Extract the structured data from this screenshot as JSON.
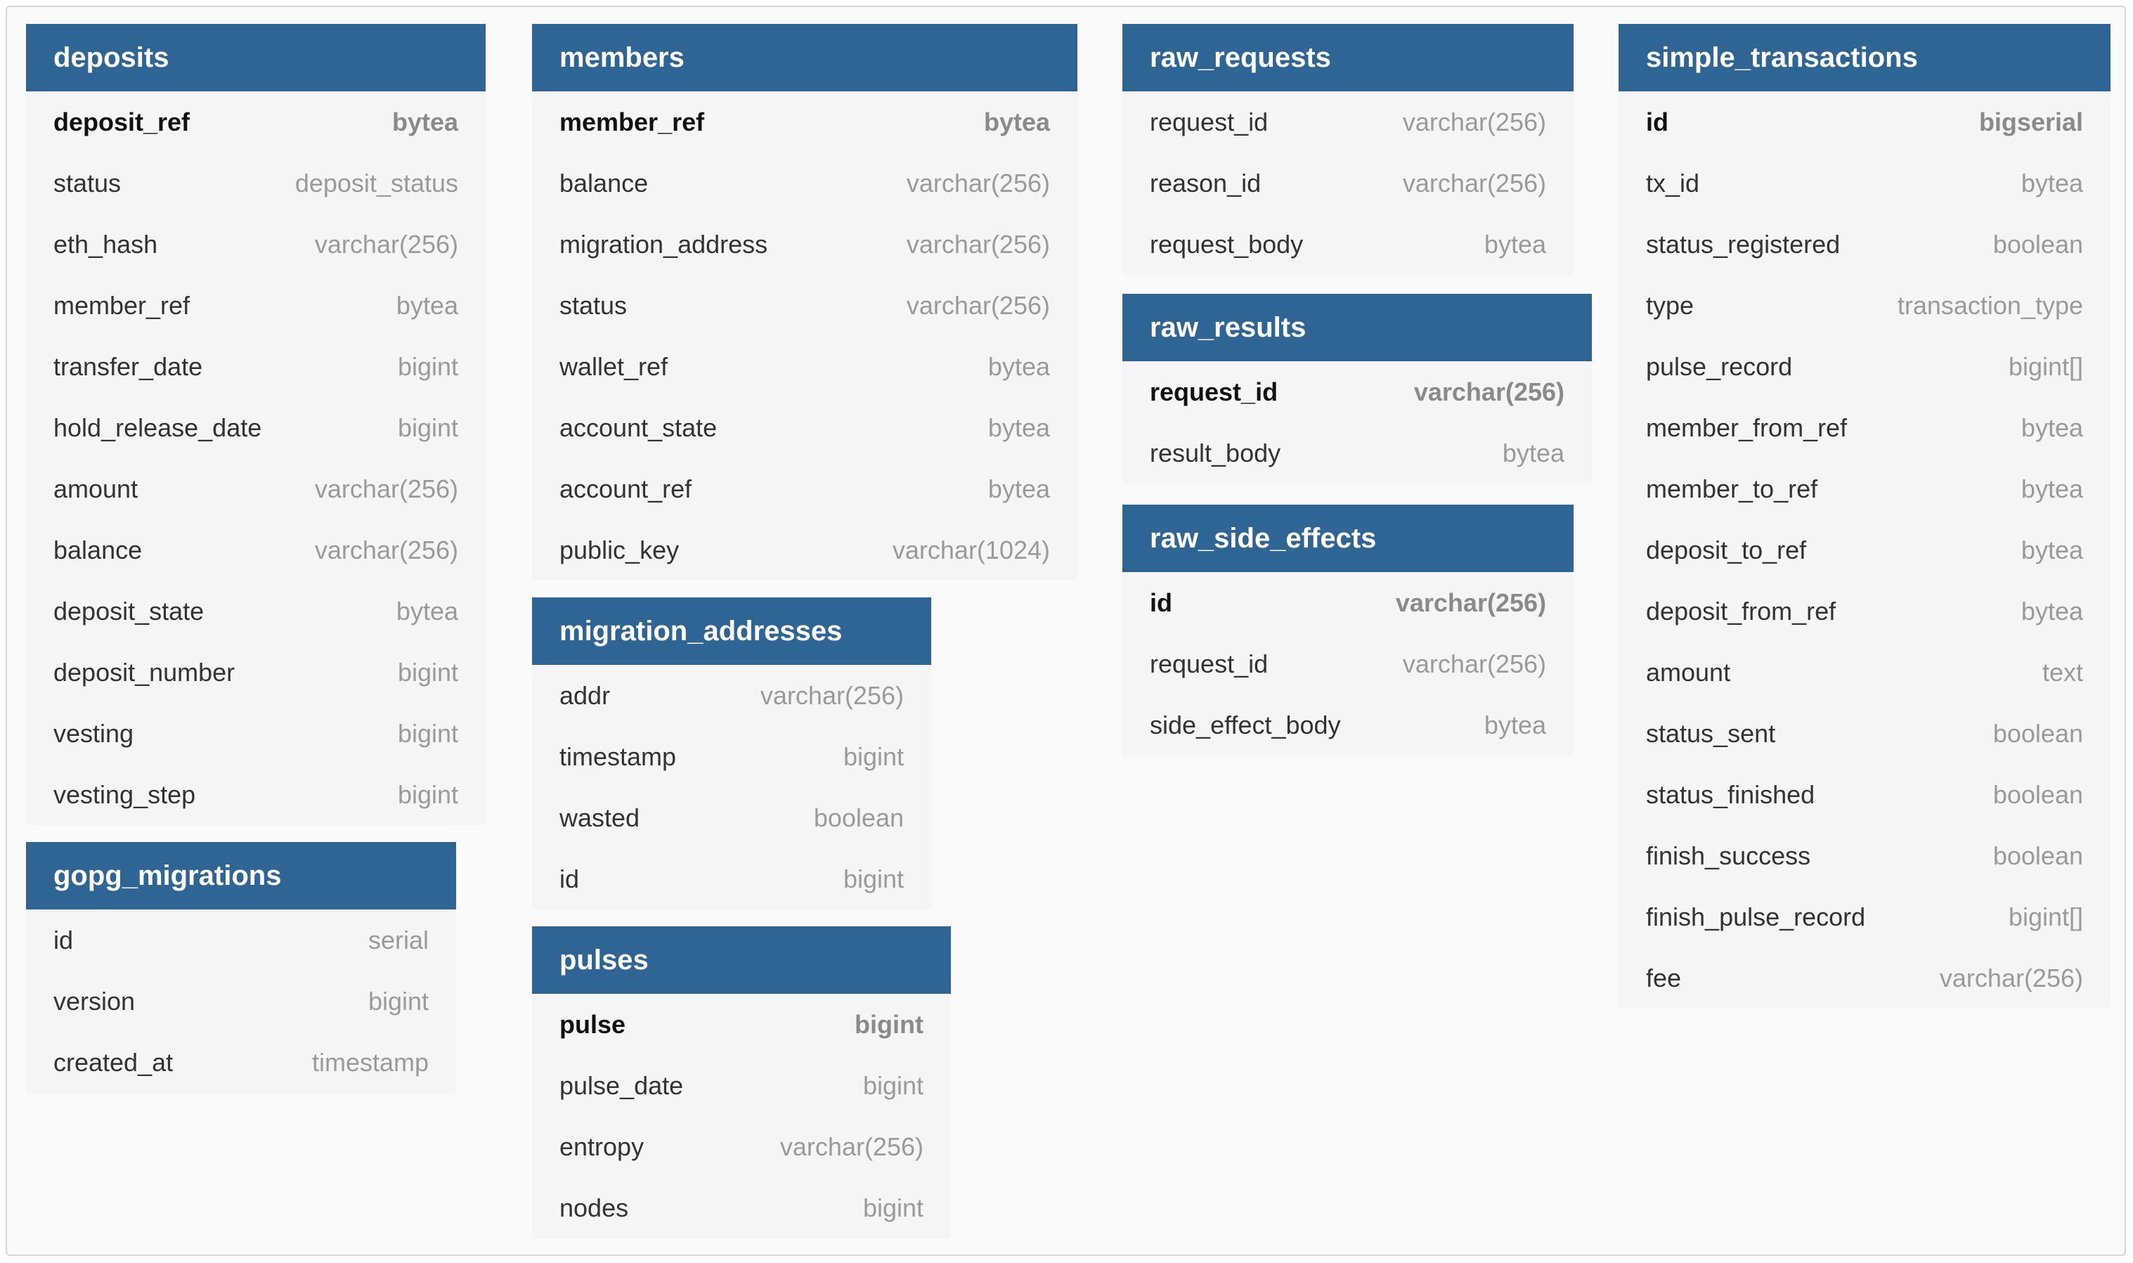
{
  "tables": {
    "deposits": {
      "name": "deposits",
      "columns": [
        {
          "name": "deposit_ref",
          "type": "bytea"
        },
        {
          "name": "status",
          "type": "deposit_status"
        },
        {
          "name": "eth_hash",
          "type": "varchar(256)"
        },
        {
          "name": "member_ref",
          "type": "bytea"
        },
        {
          "name": "transfer_date",
          "type": "bigint"
        },
        {
          "name": "hold_release_date",
          "type": "bigint"
        },
        {
          "name": "amount",
          "type": "varchar(256)"
        },
        {
          "name": "balance",
          "type": "varchar(256)"
        },
        {
          "name": "deposit_state",
          "type": "bytea"
        },
        {
          "name": "deposit_number",
          "type": "bigint"
        },
        {
          "name": "vesting",
          "type": "bigint"
        },
        {
          "name": "vesting_step",
          "type": "bigint"
        }
      ]
    },
    "gopg_migrations": {
      "name": "gopg_migrations",
      "columns": [
        {
          "name": "id",
          "type": "serial"
        },
        {
          "name": "version",
          "type": "bigint"
        },
        {
          "name": "created_at",
          "type": "timestamp"
        }
      ]
    },
    "members": {
      "name": "members",
      "columns": [
        {
          "name": "member_ref",
          "type": "bytea"
        },
        {
          "name": "balance",
          "type": "varchar(256)"
        },
        {
          "name": "migration_address",
          "type": "varchar(256)"
        },
        {
          "name": "status",
          "type": "varchar(256)"
        },
        {
          "name": "wallet_ref",
          "type": "bytea"
        },
        {
          "name": "account_state",
          "type": "bytea"
        },
        {
          "name": "account_ref",
          "type": "bytea"
        },
        {
          "name": "public_key",
          "type": "varchar(1024)"
        }
      ]
    },
    "migration_addresses": {
      "name": "migration_addresses",
      "columns": [
        {
          "name": "addr",
          "type": "varchar(256)"
        },
        {
          "name": "timestamp",
          "type": "bigint"
        },
        {
          "name": "wasted",
          "type": "boolean"
        },
        {
          "name": "id",
          "type": "bigint"
        }
      ]
    },
    "pulses": {
      "name": "pulses",
      "columns": [
        {
          "name": "pulse",
          "type": "bigint"
        },
        {
          "name": "pulse_date",
          "type": "bigint"
        },
        {
          "name": "entropy",
          "type": "varchar(256)"
        },
        {
          "name": "nodes",
          "type": "bigint"
        }
      ]
    },
    "raw_requests": {
      "name": "raw_requests",
      "columns": [
        {
          "name": "request_id",
          "type": "varchar(256)"
        },
        {
          "name": "reason_id",
          "type": "varchar(256)"
        },
        {
          "name": "request_body",
          "type": "bytea"
        }
      ]
    },
    "raw_results": {
      "name": "raw_results",
      "columns": [
        {
          "name": "request_id",
          "type": "varchar(256)"
        },
        {
          "name": "result_body",
          "type": "bytea"
        }
      ]
    },
    "raw_side_effects": {
      "name": "raw_side_effects",
      "columns": [
        {
          "name": "id",
          "type": "varchar(256)"
        },
        {
          "name": "request_id",
          "type": "varchar(256)"
        },
        {
          "name": "side_effect_body",
          "type": "bytea"
        }
      ]
    },
    "simple_transactions": {
      "name": "simple_transactions",
      "columns": [
        {
          "name": "id",
          "type": "bigserial"
        },
        {
          "name": "tx_id",
          "type": "bytea"
        },
        {
          "name": "status_registered",
          "type": "boolean"
        },
        {
          "name": "type",
          "type": "transaction_type"
        },
        {
          "name": "pulse_record",
          "type": "bigint[]"
        },
        {
          "name": "member_from_ref",
          "type": "bytea"
        },
        {
          "name": "member_to_ref",
          "type": "bytea"
        },
        {
          "name": "deposit_to_ref",
          "type": "bytea"
        },
        {
          "name": "deposit_from_ref",
          "type": "bytea"
        },
        {
          "name": "amount",
          "type": "text"
        },
        {
          "name": "status_sent",
          "type": "boolean"
        },
        {
          "name": "status_finished",
          "type": "boolean"
        },
        {
          "name": "finish_success",
          "type": "boolean"
        },
        {
          "name": "finish_pulse_record",
          "type": "bigint[]"
        },
        {
          "name": "fee",
          "type": "varchar(256)"
        }
      ]
    }
  },
  "colors": {
    "header": "#2f6595",
    "body": "#f5f5f5",
    "canvas": "#fafafa"
  }
}
